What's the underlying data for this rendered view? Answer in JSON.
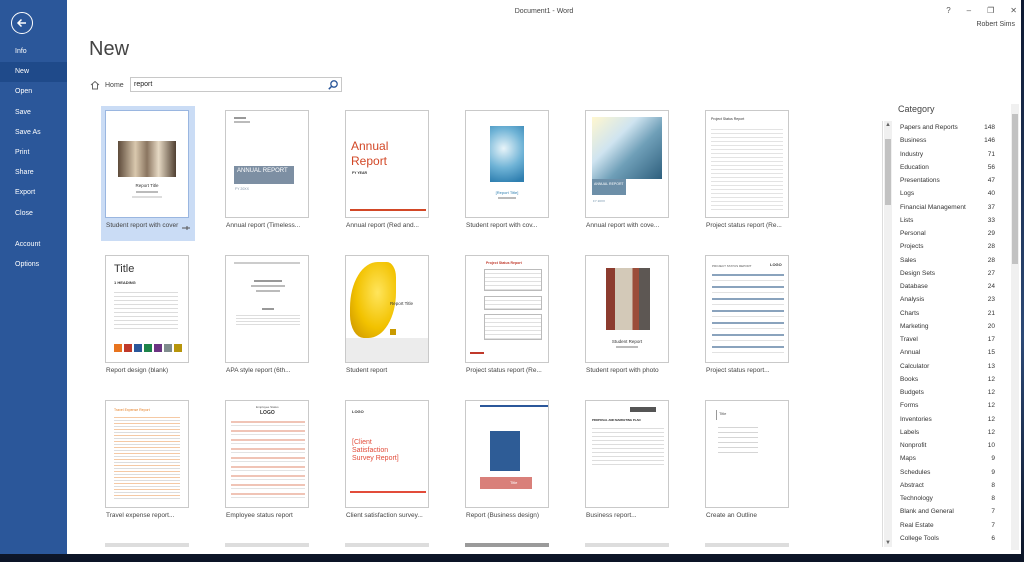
{
  "window": {
    "title": "Document1 - Word",
    "help": "?",
    "minimize": "–",
    "restore": "❐",
    "close": "✕",
    "user": "Robert Sims"
  },
  "sidebar": {
    "items": [
      {
        "label": "Info"
      },
      {
        "label": "New",
        "active": true
      },
      {
        "label": "Open"
      },
      {
        "label": "Save"
      },
      {
        "label": "Save As"
      },
      {
        "label": "Print"
      },
      {
        "label": "Share"
      },
      {
        "label": "Export"
      },
      {
        "label": "Close"
      },
      {
        "label": "Account"
      },
      {
        "label": "Options"
      }
    ]
  },
  "main": {
    "title": "New",
    "home": "Home",
    "search_value": "report",
    "icons": {
      "back": "back-arrow-icon",
      "home": "home-icon",
      "search": "search-icon",
      "pin": "pin-icon"
    }
  },
  "templates": [
    {
      "label": "Student report with cover",
      "selected": true
    },
    {
      "label": "Annual report (Timeless..."
    },
    {
      "label": "Annual report (Red and..."
    },
    {
      "label": "Student report with cov..."
    },
    {
      "label": "Annual report with cove..."
    },
    {
      "label": "Project status report (Re..."
    },
    {
      "label": "Report design (blank)"
    },
    {
      "label": "APA style report (6th..."
    },
    {
      "label": "Student report"
    },
    {
      "label": "Project status report (Re..."
    },
    {
      "label": "Student report with photo"
    },
    {
      "label": "Project status report..."
    },
    {
      "label": "Travel expense report..."
    },
    {
      "label": "Employee status report"
    },
    {
      "label": "Client satisfaction survey..."
    },
    {
      "label": "Report (Business design)"
    },
    {
      "label": "Business report..."
    },
    {
      "label": "Create an Outline"
    }
  ],
  "thumb_text": {
    "t1_title": "Report Title",
    "t2_title": "ANNUAL REPORT",
    "t2_year": "FY 20XX",
    "t3_line1": "Annual",
    "t3_line2": "Report",
    "t3_year": "FY YEAR",
    "t4_title": "[Report Title]",
    "t5_title": "ANNUAL REPORT",
    "t5_year": "FY 20XX",
    "t6_title": "Project Status Report",
    "t7_title": "Title",
    "t7_heading": "1   HEADING",
    "t9_title": "Report Title",
    "t10_title": "Project Status Report",
    "t11_title": "Student Report",
    "t12_title": "PROJECT STATUS REPORT",
    "t12_logo": "LOGO",
    "t13_title": "Travel Expense Report",
    "t14_title": "Employee Status",
    "t14_logo": "LOGO",
    "t15_logo": "LOGO",
    "t15_title": "[Client Satisfaction Survey Report]",
    "t16_title": "Title",
    "t17_title": "PROPOSAL AND MARKETING PLAN",
    "t18_title": "Title"
  },
  "thumb_colors": {
    "t7": [
      "#e8741e",
      "#c0392b",
      "#2b579a",
      "#1e8449",
      "#6c3483",
      "#7f8c8d",
      "#b7950b"
    ]
  },
  "category": {
    "title": "Category",
    "items": [
      {
        "name": "Papers and Reports",
        "count": "148"
      },
      {
        "name": "Business",
        "count": "146"
      },
      {
        "name": "Industry",
        "count": "71"
      },
      {
        "name": "Education",
        "count": "56"
      },
      {
        "name": "Presentations",
        "count": "47"
      },
      {
        "name": "Logs",
        "count": "40"
      },
      {
        "name": "Financial Management",
        "count": "37"
      },
      {
        "name": "Lists",
        "count": "33"
      },
      {
        "name": "Personal",
        "count": "29"
      },
      {
        "name": "Projects",
        "count": "28"
      },
      {
        "name": "Sales",
        "count": "28"
      },
      {
        "name": "Design Sets",
        "count": "27"
      },
      {
        "name": "Database",
        "count": "24"
      },
      {
        "name": "Analysis",
        "count": "23"
      },
      {
        "name": "Charts",
        "count": "21"
      },
      {
        "name": "Marketing",
        "count": "20"
      },
      {
        "name": "Travel",
        "count": "17"
      },
      {
        "name": "Annual",
        "count": "15"
      },
      {
        "name": "Calculator",
        "count": "13"
      },
      {
        "name": "Books",
        "count": "12"
      },
      {
        "name": "Budgets",
        "count": "12"
      },
      {
        "name": "Forms",
        "count": "12"
      },
      {
        "name": "Inventories",
        "count": "12"
      },
      {
        "name": "Labels",
        "count": "12"
      },
      {
        "name": "Nonprofit",
        "count": "10"
      },
      {
        "name": "Maps",
        "count": "9"
      },
      {
        "name": "Schedules",
        "count": "9"
      },
      {
        "name": "Abstract",
        "count": "8"
      },
      {
        "name": "Technology",
        "count": "8"
      },
      {
        "name": "Blank and General",
        "count": "7"
      },
      {
        "name": "Real Estate",
        "count": "7"
      },
      {
        "name": "College Tools",
        "count": "6"
      }
    ]
  },
  "colors": {
    "accent": "#2b579a",
    "selected_tile": "#cadcf5",
    "red": "#c0392b"
  }
}
